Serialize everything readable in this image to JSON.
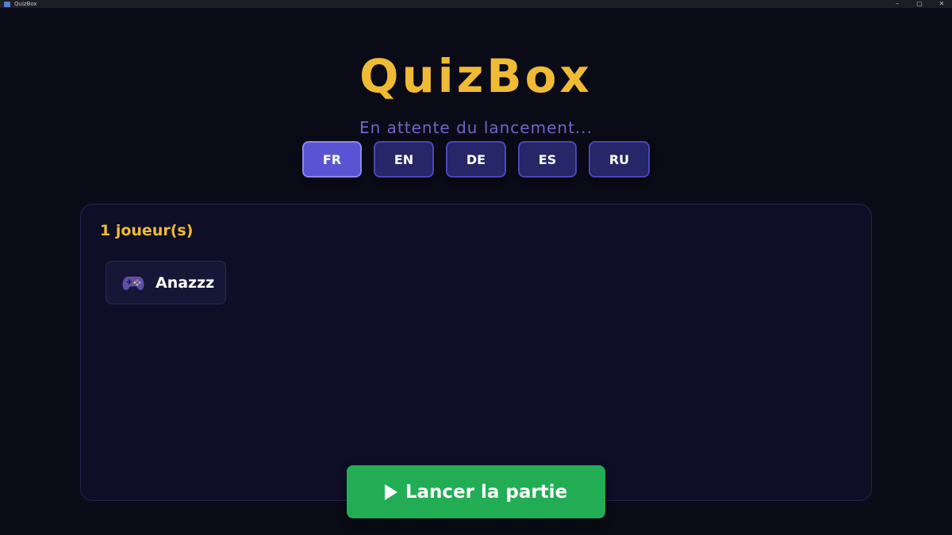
{
  "window": {
    "title": "QuizBox",
    "controls": [
      "–",
      "▢",
      "✕"
    ]
  },
  "app": {
    "logo": "QuizBox",
    "status": "En attente du lancement...",
    "languages": [
      {
        "code": "FR",
        "active": true
      },
      {
        "code": "EN",
        "active": false
      },
      {
        "code": "DE",
        "active": false
      },
      {
        "code": "ES",
        "active": false
      },
      {
        "code": "RU",
        "active": false
      }
    ],
    "players": {
      "count_label": "1 joueur(s)",
      "list": [
        {
          "name": "Anazzz",
          "icon": "gamepad-icon"
        }
      ]
    },
    "start_button": {
      "label": "Lancer la partie",
      "icon": "play-icon"
    }
  },
  "colors": {
    "background": "#0b0b17",
    "accent_gold": "#f0bb34",
    "status_purple": "#6f65c7",
    "lang_button": "#262668",
    "lang_button_active": "#5b54d2",
    "panel": "#0e0e27",
    "start_green": "#22ad55"
  }
}
